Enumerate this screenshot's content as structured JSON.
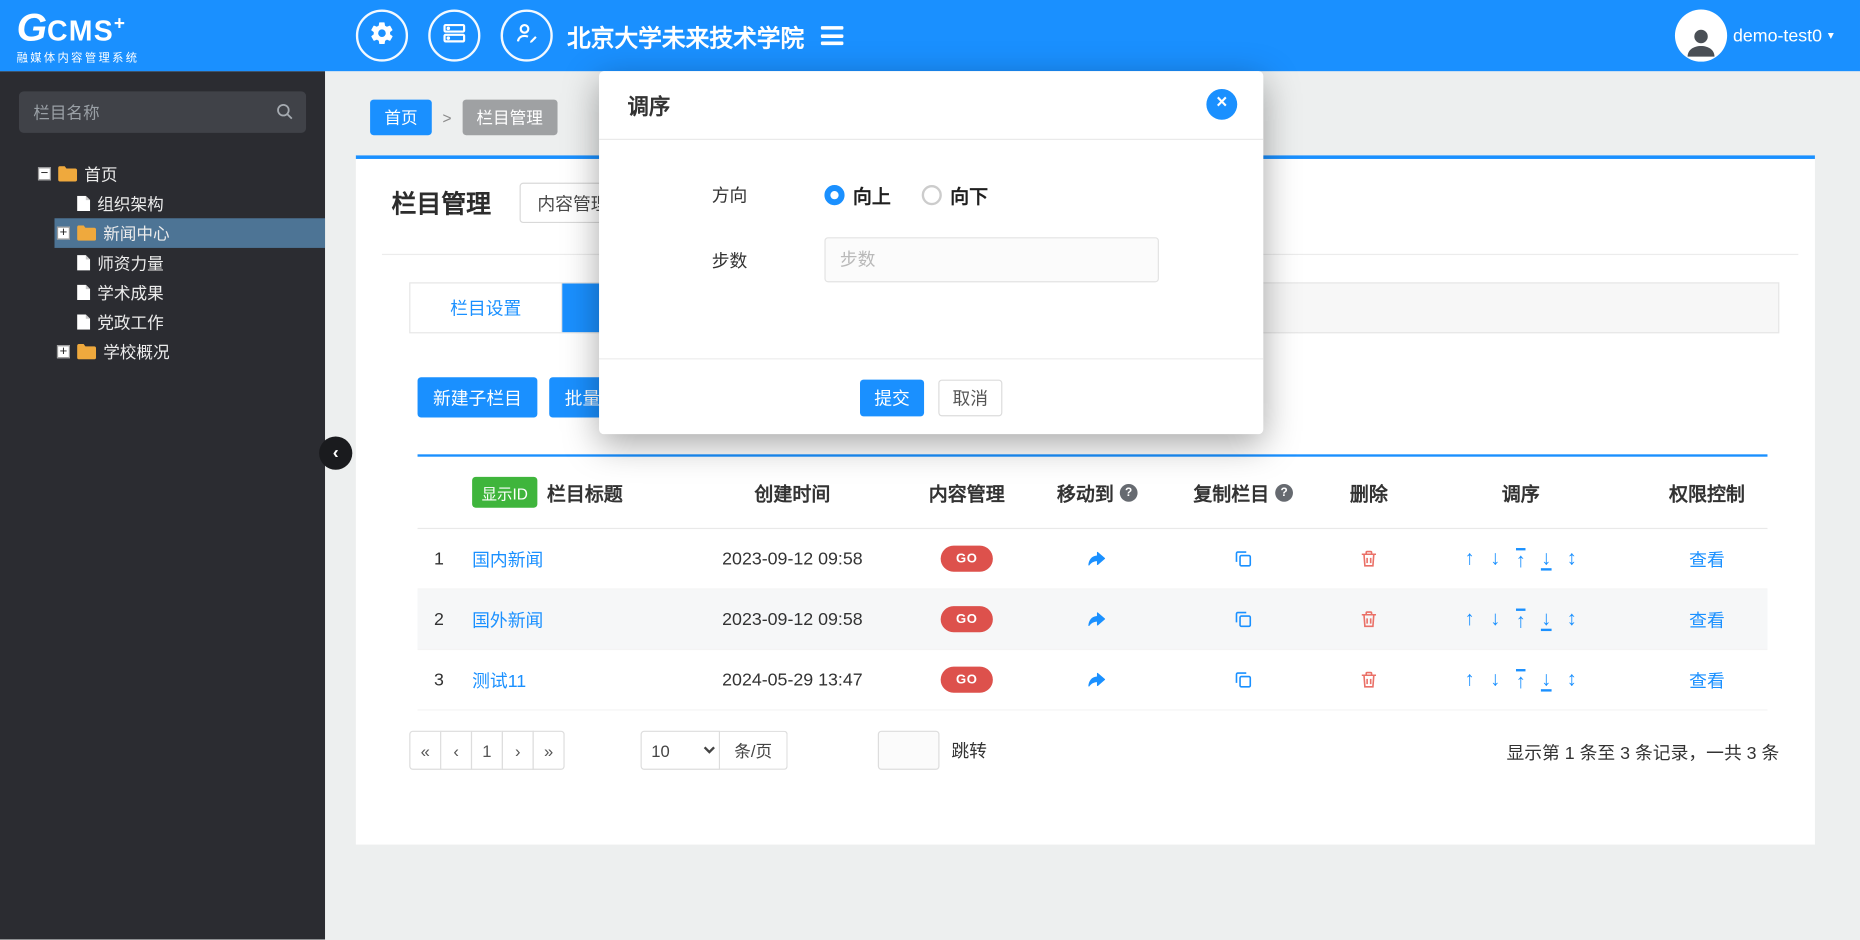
{
  "header": {
    "logo": {
      "g": "G",
      "cms": "CMS",
      "plus": "+",
      "subtitle": "融媒体内容管理系统"
    },
    "site_title": "北京大学未来技术学院",
    "user_name": "demo-test0"
  },
  "sidebar": {
    "search_placeholder": "栏目名称",
    "tree": [
      {
        "label": "首页"
      },
      {
        "label": "组织架构"
      },
      {
        "label": "新闻中心"
      },
      {
        "label": "师资力量"
      },
      {
        "label": "学术成果"
      },
      {
        "label": "党政工作"
      },
      {
        "label": "学校概况"
      }
    ]
  },
  "breadcrumb": {
    "home": "首页",
    "separator": ">",
    "current": "栏目管理"
  },
  "content": {
    "title": "栏目管理",
    "manage_button": "内容管理",
    "tab_settings": "栏目设置",
    "btn_new_child": "新建子栏目",
    "btn_batch_new": "批量新建"
  },
  "table": {
    "show_id": "显示ID",
    "headers": {
      "title": "栏目标题",
      "created": "创建时间",
      "content": "内容管理",
      "move": "移动到",
      "copy": "复制栏目",
      "del": "删除",
      "sort": "调序",
      "perm": "权限控制"
    },
    "go": "GO",
    "view": "查看",
    "rows": [
      {
        "num": "1",
        "title": "国内新闻",
        "created": "2023-09-12 09:58"
      },
      {
        "num": "2",
        "title": "国外新闻",
        "created": "2023-09-12 09:58"
      },
      {
        "num": "3",
        "title": "测试11",
        "created": "2024-05-29 13:47"
      }
    ]
  },
  "pagination": {
    "first": "«",
    "prev": "‹",
    "page": "1",
    "next": "›",
    "last": "»",
    "size": "10",
    "unit": "条/页",
    "jump": "跳转",
    "info": "显示第 1 条至 3 条记录，一共 3 条"
  },
  "modal": {
    "title": "调序",
    "direction_label": "方向",
    "up": "向上",
    "down": "向下",
    "steps_label": "步数",
    "steps_placeholder": "步数",
    "submit": "提交",
    "cancel": "取消"
  },
  "colors": {
    "primary": "#1a90ff",
    "danger": "#dd514c",
    "success": "#3fb53c",
    "sidebar_bg": "#2b2c31"
  }
}
